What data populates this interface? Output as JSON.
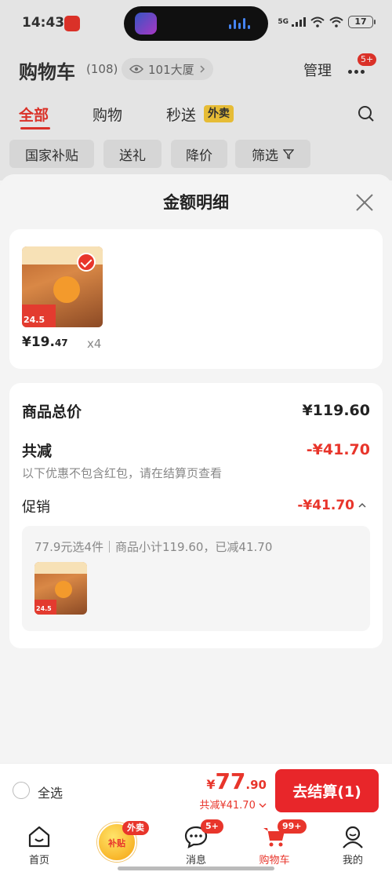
{
  "status_bar": {
    "time": "14:43",
    "signal_label": "5G",
    "battery": "17"
  },
  "header": {
    "title": "购物车",
    "count": "(108)",
    "location": "101大厦",
    "manage_label": "管理",
    "more_badge": "5+"
  },
  "tabs": [
    {
      "label": "全部",
      "active": true
    },
    {
      "label": "购物",
      "active": false
    },
    {
      "label": "秒送",
      "active": false
    }
  ],
  "waimai_tag": "外卖",
  "chips": [
    "国家补贴",
    "送礼",
    "降价",
    "筛选"
  ],
  "sheet": {
    "title": "金额明细",
    "product": {
      "price_main": "¥19.",
      "price_decimal": "47",
      "qty": "x4",
      "thumb_tag": "24.5"
    },
    "summary": {
      "total_label": "商品总价",
      "total_value": "¥119.60",
      "reduce_label": "共减",
      "reduce_value": "-¥41.70",
      "reduce_note": "以下优惠不包含红包，请在结算页查看",
      "promo_label": "促销",
      "promo_value": "-¥41.70",
      "promo_desc": "77.9元选4件｜商品小计119.60，已减41.70"
    }
  },
  "checkout": {
    "select_all": "全选",
    "total_currency": "¥",
    "total_int": "77",
    "total_dec": ".90",
    "discount": "共减¥41.70",
    "button": "去结算(1)"
  },
  "tabbar": {
    "items": [
      {
        "label": "首页",
        "icon": "home-icon"
      },
      {
        "label": "",
        "icon": "subsidy-icon",
        "badge": "外卖",
        "center_text": "补贴"
      },
      {
        "label": "消息",
        "icon": "message-icon",
        "badge": "5+"
      },
      {
        "label": "购物车",
        "icon": "cart-icon",
        "badge": "99+",
        "active": true
      },
      {
        "label": "我的",
        "icon": "profile-icon"
      }
    ]
  },
  "colors": {
    "accent": "#e8352b",
    "waimai_tag": "#f5c83a",
    "subsidy": "#f5a20f"
  }
}
